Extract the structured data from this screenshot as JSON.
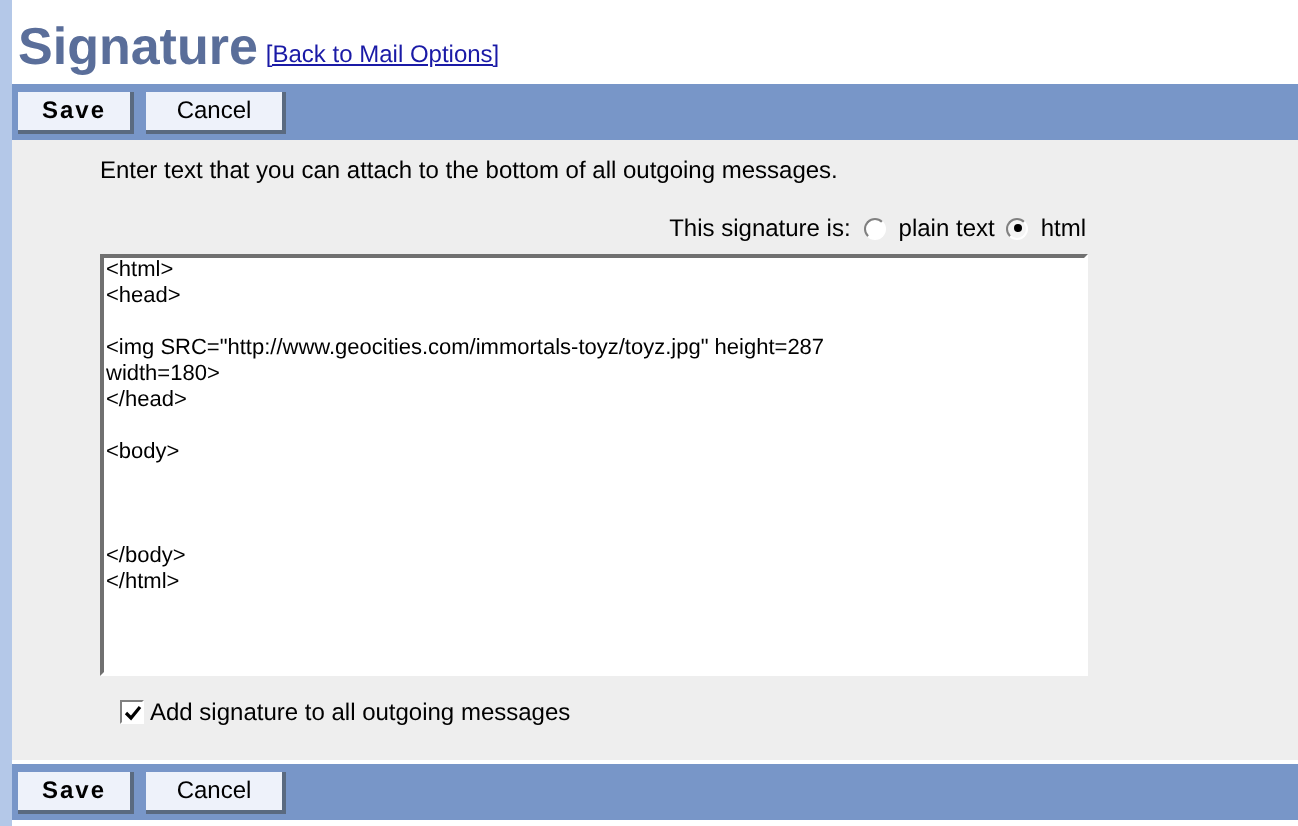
{
  "title": "Signature",
  "back_link": "[Back to Mail Options]",
  "top_toolbar": {
    "buttons": [
      {
        "label": "Save",
        "kind": "primary"
      },
      {
        "label": "Cancel",
        "kind": "secondary"
      }
    ]
  },
  "instructions": "Enter text that you can attach to the bottom of all outgoing messages.",
  "format": {
    "label": "This signature is:",
    "options": [
      {
        "label": "plain text",
        "selected": false
      },
      {
        "label": "html",
        "selected": true
      }
    ]
  },
  "signature_text": "<html>\n<head>\n\n<img SRC=\"http://www.geocities.com/immortals-toyz/toyz.jpg\" height=287\nwidth=180>\n</head>\n\n<body>\n\n\n\n</body>\n</html>",
  "add_to_all": {
    "label": "Add signature to all outgoing messages",
    "checked": true
  },
  "bottom_toolbar": {
    "buttons": [
      {
        "label": "Save",
        "kind": "primary"
      },
      {
        "label": "Cancel",
        "kind": "secondary"
      }
    ]
  }
}
